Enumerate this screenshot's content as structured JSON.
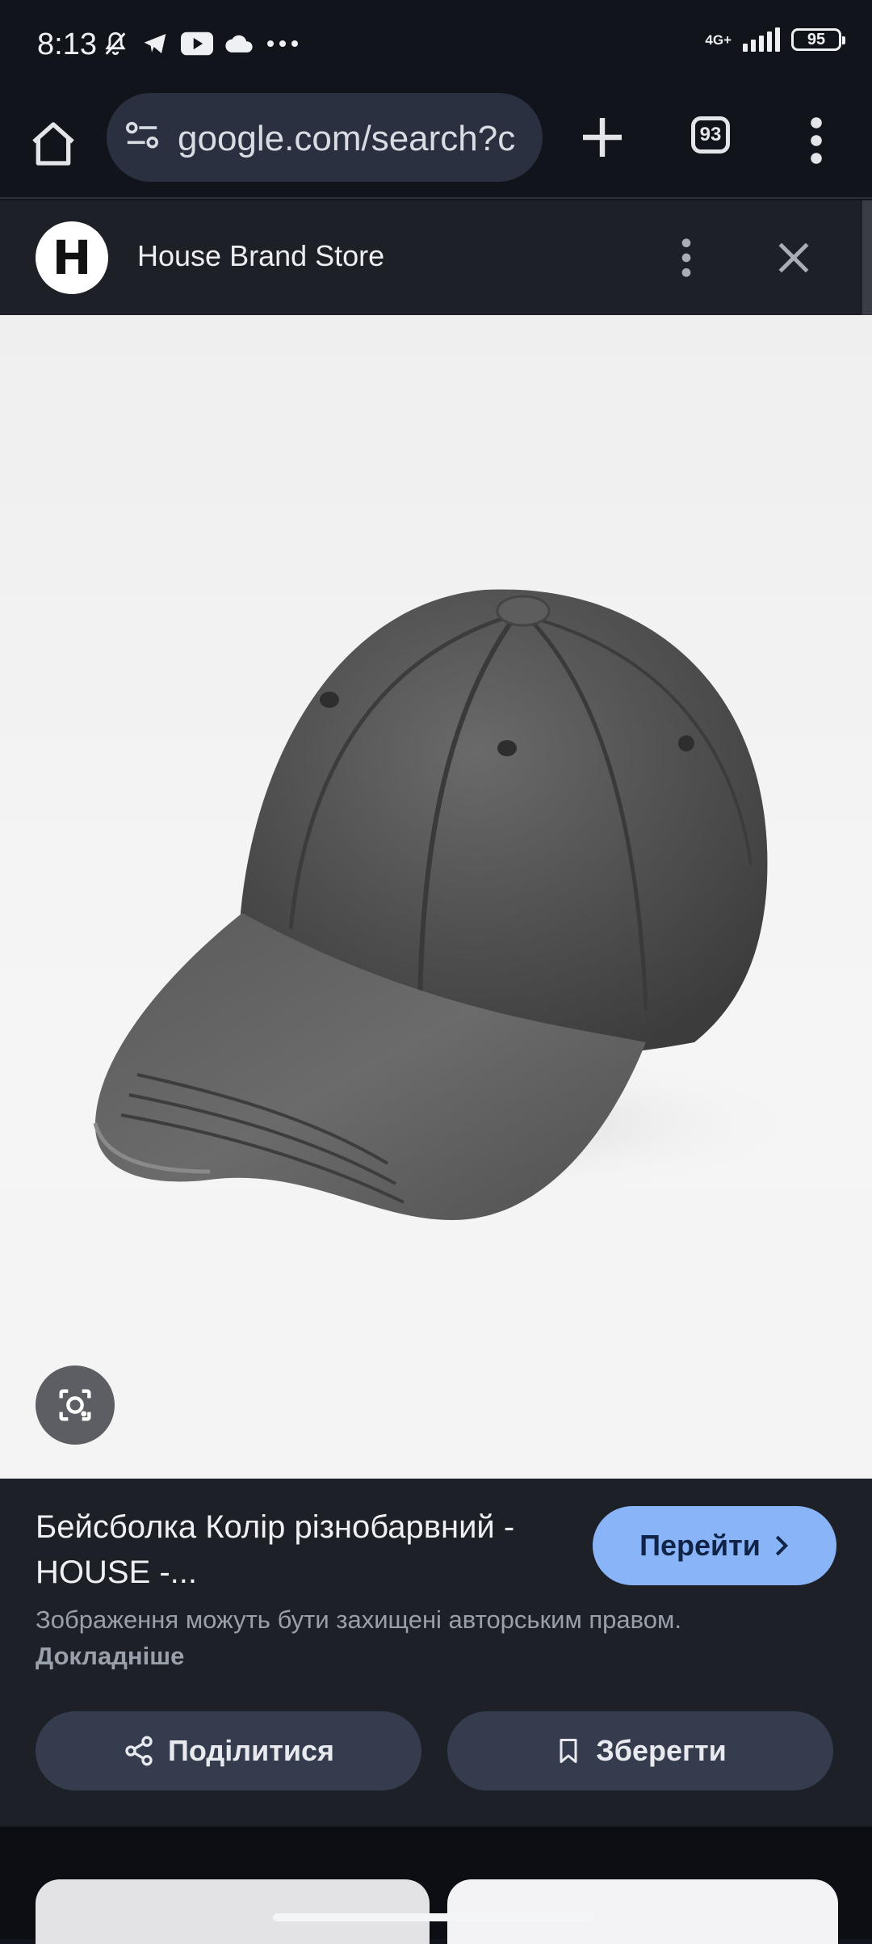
{
  "status_bar": {
    "time": "8:13",
    "network": "4G+",
    "battery": "95"
  },
  "toolbar": {
    "url": "google.com/search?c",
    "tab_count": "93"
  },
  "source": {
    "favicon_letter": "H",
    "name": "House Brand Store"
  },
  "image": {
    "subject": "grey denim baseball cap"
  },
  "product": {
    "title": "Бейсболка Колір різнобарвний - HOUSE -...",
    "visit_label": "Перейти",
    "copyright_text": "Зображення можуть бути захищені авторським правом.",
    "learn_more": "Докладніше",
    "share_label": "Поділитися",
    "save_label": "Зберегти"
  },
  "colors": {
    "accent": "#8ab4f8",
    "panel": "#1e2027",
    "background": "#11141b"
  }
}
